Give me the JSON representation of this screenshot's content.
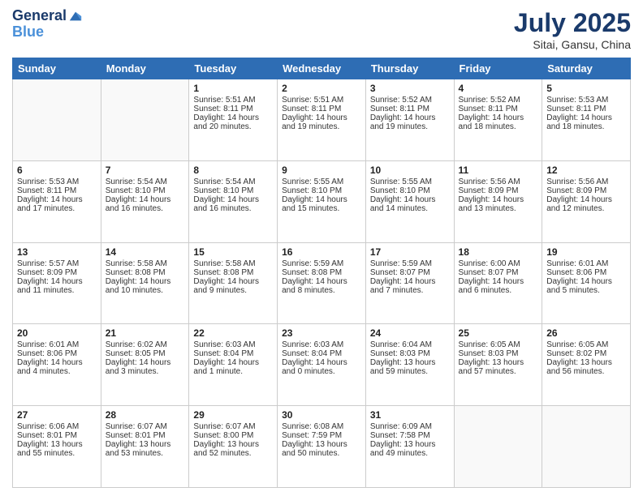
{
  "logo": {
    "line1": "General",
    "line2": "Blue"
  },
  "title": "July 2025",
  "subtitle": "Sitai, Gansu, China",
  "days_of_week": [
    "Sunday",
    "Monday",
    "Tuesday",
    "Wednesday",
    "Thursday",
    "Friday",
    "Saturday"
  ],
  "weeks": [
    [
      {
        "day": "",
        "info": ""
      },
      {
        "day": "",
        "info": ""
      },
      {
        "day": "1",
        "info": "Sunrise: 5:51 AM\nSunset: 8:11 PM\nDaylight: 14 hours and 20 minutes."
      },
      {
        "day": "2",
        "info": "Sunrise: 5:51 AM\nSunset: 8:11 PM\nDaylight: 14 hours and 19 minutes."
      },
      {
        "day": "3",
        "info": "Sunrise: 5:52 AM\nSunset: 8:11 PM\nDaylight: 14 hours and 19 minutes."
      },
      {
        "day": "4",
        "info": "Sunrise: 5:52 AM\nSunset: 8:11 PM\nDaylight: 14 hours and 18 minutes."
      },
      {
        "day": "5",
        "info": "Sunrise: 5:53 AM\nSunset: 8:11 PM\nDaylight: 14 hours and 18 minutes."
      }
    ],
    [
      {
        "day": "6",
        "info": "Sunrise: 5:53 AM\nSunset: 8:11 PM\nDaylight: 14 hours and 17 minutes."
      },
      {
        "day": "7",
        "info": "Sunrise: 5:54 AM\nSunset: 8:10 PM\nDaylight: 14 hours and 16 minutes."
      },
      {
        "day": "8",
        "info": "Sunrise: 5:54 AM\nSunset: 8:10 PM\nDaylight: 14 hours and 16 minutes."
      },
      {
        "day": "9",
        "info": "Sunrise: 5:55 AM\nSunset: 8:10 PM\nDaylight: 14 hours and 15 minutes."
      },
      {
        "day": "10",
        "info": "Sunrise: 5:55 AM\nSunset: 8:10 PM\nDaylight: 14 hours and 14 minutes."
      },
      {
        "day": "11",
        "info": "Sunrise: 5:56 AM\nSunset: 8:09 PM\nDaylight: 14 hours and 13 minutes."
      },
      {
        "day": "12",
        "info": "Sunrise: 5:56 AM\nSunset: 8:09 PM\nDaylight: 14 hours and 12 minutes."
      }
    ],
    [
      {
        "day": "13",
        "info": "Sunrise: 5:57 AM\nSunset: 8:09 PM\nDaylight: 14 hours and 11 minutes."
      },
      {
        "day": "14",
        "info": "Sunrise: 5:58 AM\nSunset: 8:08 PM\nDaylight: 14 hours and 10 minutes."
      },
      {
        "day": "15",
        "info": "Sunrise: 5:58 AM\nSunset: 8:08 PM\nDaylight: 14 hours and 9 minutes."
      },
      {
        "day": "16",
        "info": "Sunrise: 5:59 AM\nSunset: 8:08 PM\nDaylight: 14 hours and 8 minutes."
      },
      {
        "day": "17",
        "info": "Sunrise: 5:59 AM\nSunset: 8:07 PM\nDaylight: 14 hours and 7 minutes."
      },
      {
        "day": "18",
        "info": "Sunrise: 6:00 AM\nSunset: 8:07 PM\nDaylight: 14 hours and 6 minutes."
      },
      {
        "day": "19",
        "info": "Sunrise: 6:01 AM\nSunset: 8:06 PM\nDaylight: 14 hours and 5 minutes."
      }
    ],
    [
      {
        "day": "20",
        "info": "Sunrise: 6:01 AM\nSunset: 8:06 PM\nDaylight: 14 hours and 4 minutes."
      },
      {
        "day": "21",
        "info": "Sunrise: 6:02 AM\nSunset: 8:05 PM\nDaylight: 14 hours and 3 minutes."
      },
      {
        "day": "22",
        "info": "Sunrise: 6:03 AM\nSunset: 8:04 PM\nDaylight: 14 hours and 1 minute."
      },
      {
        "day": "23",
        "info": "Sunrise: 6:03 AM\nSunset: 8:04 PM\nDaylight: 14 hours and 0 minutes."
      },
      {
        "day": "24",
        "info": "Sunrise: 6:04 AM\nSunset: 8:03 PM\nDaylight: 13 hours and 59 minutes."
      },
      {
        "day": "25",
        "info": "Sunrise: 6:05 AM\nSunset: 8:03 PM\nDaylight: 13 hours and 57 minutes."
      },
      {
        "day": "26",
        "info": "Sunrise: 6:05 AM\nSunset: 8:02 PM\nDaylight: 13 hours and 56 minutes."
      }
    ],
    [
      {
        "day": "27",
        "info": "Sunrise: 6:06 AM\nSunset: 8:01 PM\nDaylight: 13 hours and 55 minutes."
      },
      {
        "day": "28",
        "info": "Sunrise: 6:07 AM\nSunset: 8:01 PM\nDaylight: 13 hours and 53 minutes."
      },
      {
        "day": "29",
        "info": "Sunrise: 6:07 AM\nSunset: 8:00 PM\nDaylight: 13 hours and 52 minutes."
      },
      {
        "day": "30",
        "info": "Sunrise: 6:08 AM\nSunset: 7:59 PM\nDaylight: 13 hours and 50 minutes."
      },
      {
        "day": "31",
        "info": "Sunrise: 6:09 AM\nSunset: 7:58 PM\nDaylight: 13 hours and 49 minutes."
      },
      {
        "day": "",
        "info": ""
      },
      {
        "day": "",
        "info": ""
      }
    ]
  ]
}
